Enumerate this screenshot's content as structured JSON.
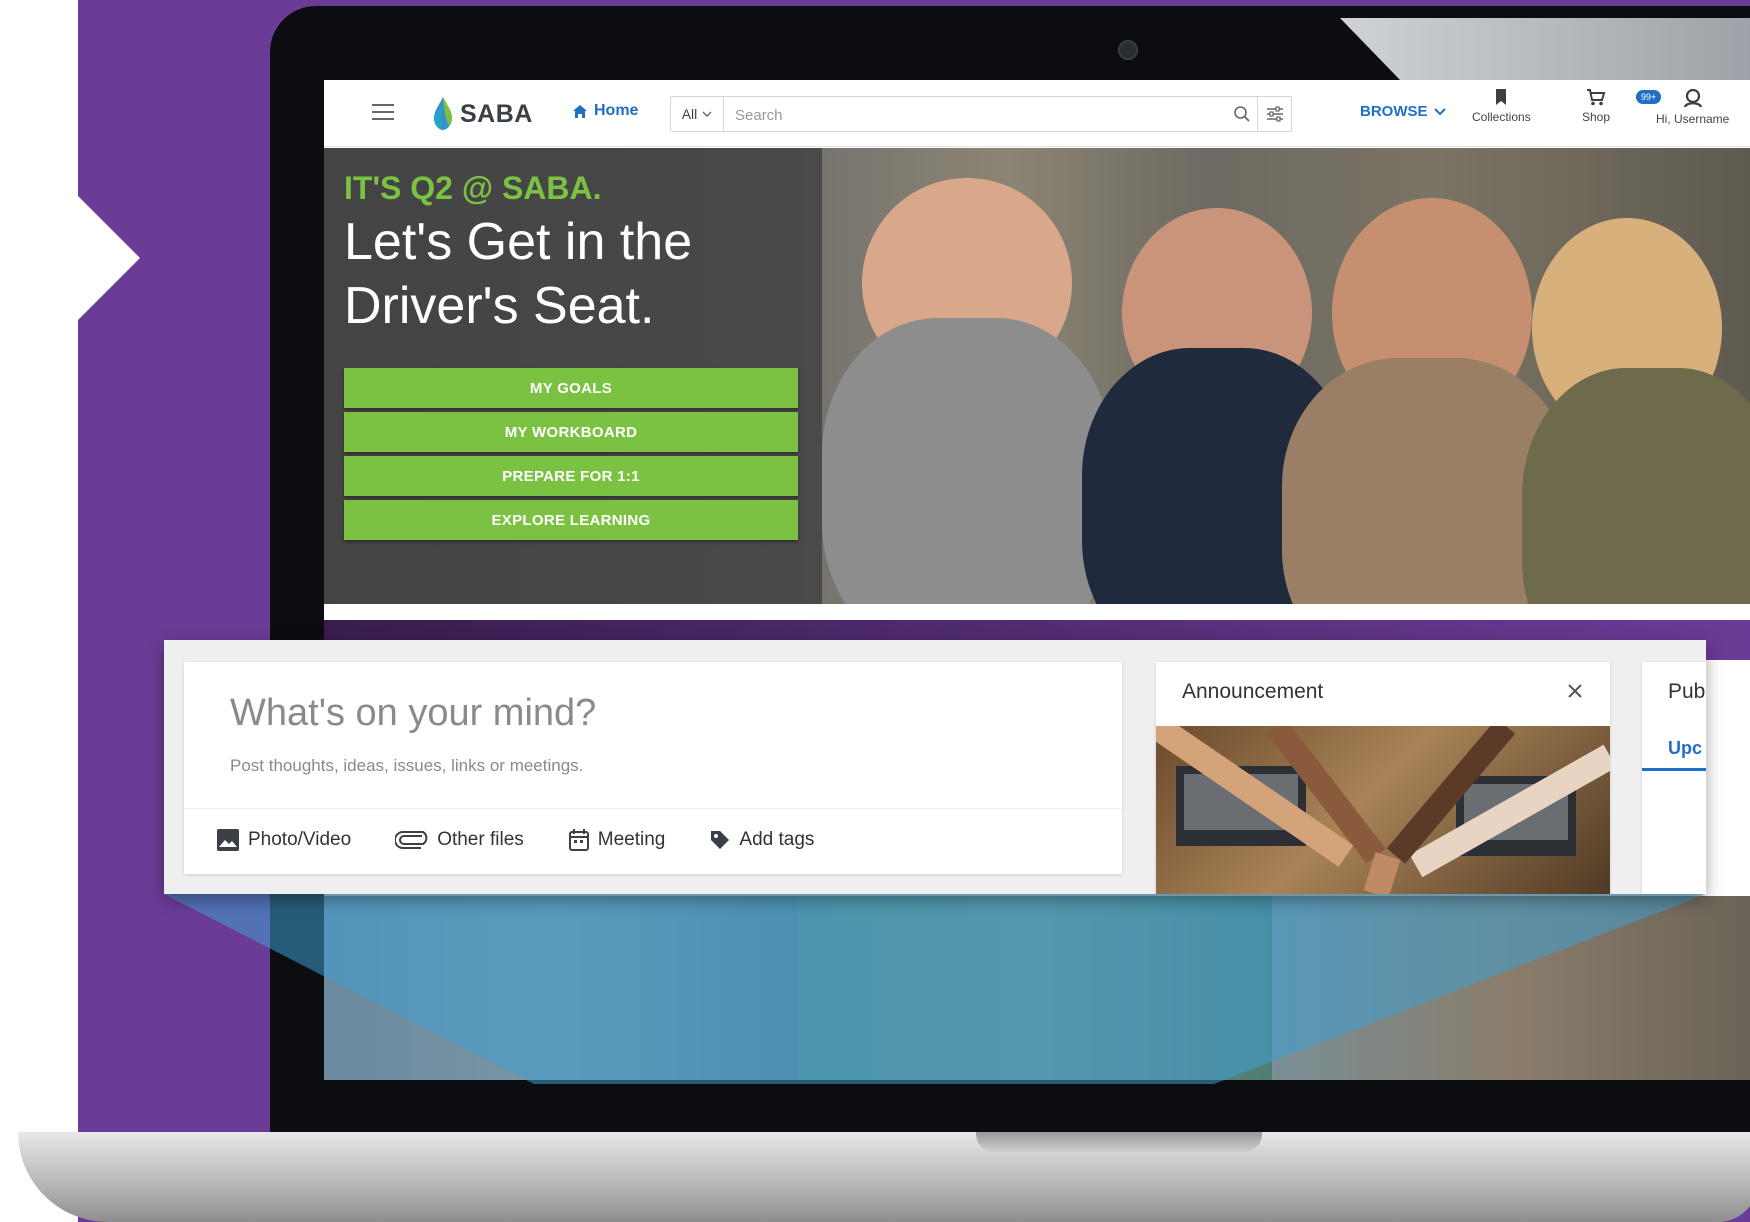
{
  "nav": {
    "logo_text": "SABA",
    "home_label": "Home",
    "search_scope": "All",
    "search_placeholder": "Search",
    "browse_label": "BROWSE",
    "collections_label": "Collections",
    "shop_label": "Shop",
    "user_label": "Hi, Username",
    "notification_count": "99+"
  },
  "hero": {
    "eyebrow": "IT'S Q2 @ SABA.",
    "title": "Let's Get in the Driver's Seat.",
    "buttons": [
      "MY GOALS",
      "MY WORKBOARD",
      "PREPARE FOR 1:1",
      "EXPLORE LEARNING"
    ]
  },
  "post": {
    "prompt": "What's on your mind?",
    "hint": "Post thoughts, ideas, issues, links or meetings.",
    "actions": [
      "Photo/Video",
      "Other files",
      "Meeting",
      "Add tags"
    ]
  },
  "announcement": {
    "title": "Announcement"
  },
  "pub_panel": {
    "title": "Pub",
    "tab": "Upc"
  },
  "colors": {
    "brand_purple": "#6b3c97",
    "saba_green": "#7cc242",
    "link_blue": "#1f6fc7"
  },
  "icons": [
    "hamburger-icon",
    "home-icon",
    "chevron-down-icon",
    "search-icon",
    "filter-icon",
    "bookmark-icon",
    "cart-icon",
    "user-icon",
    "image-icon",
    "paperclip-icon",
    "calendar-icon",
    "tag-icon",
    "close-icon"
  ]
}
